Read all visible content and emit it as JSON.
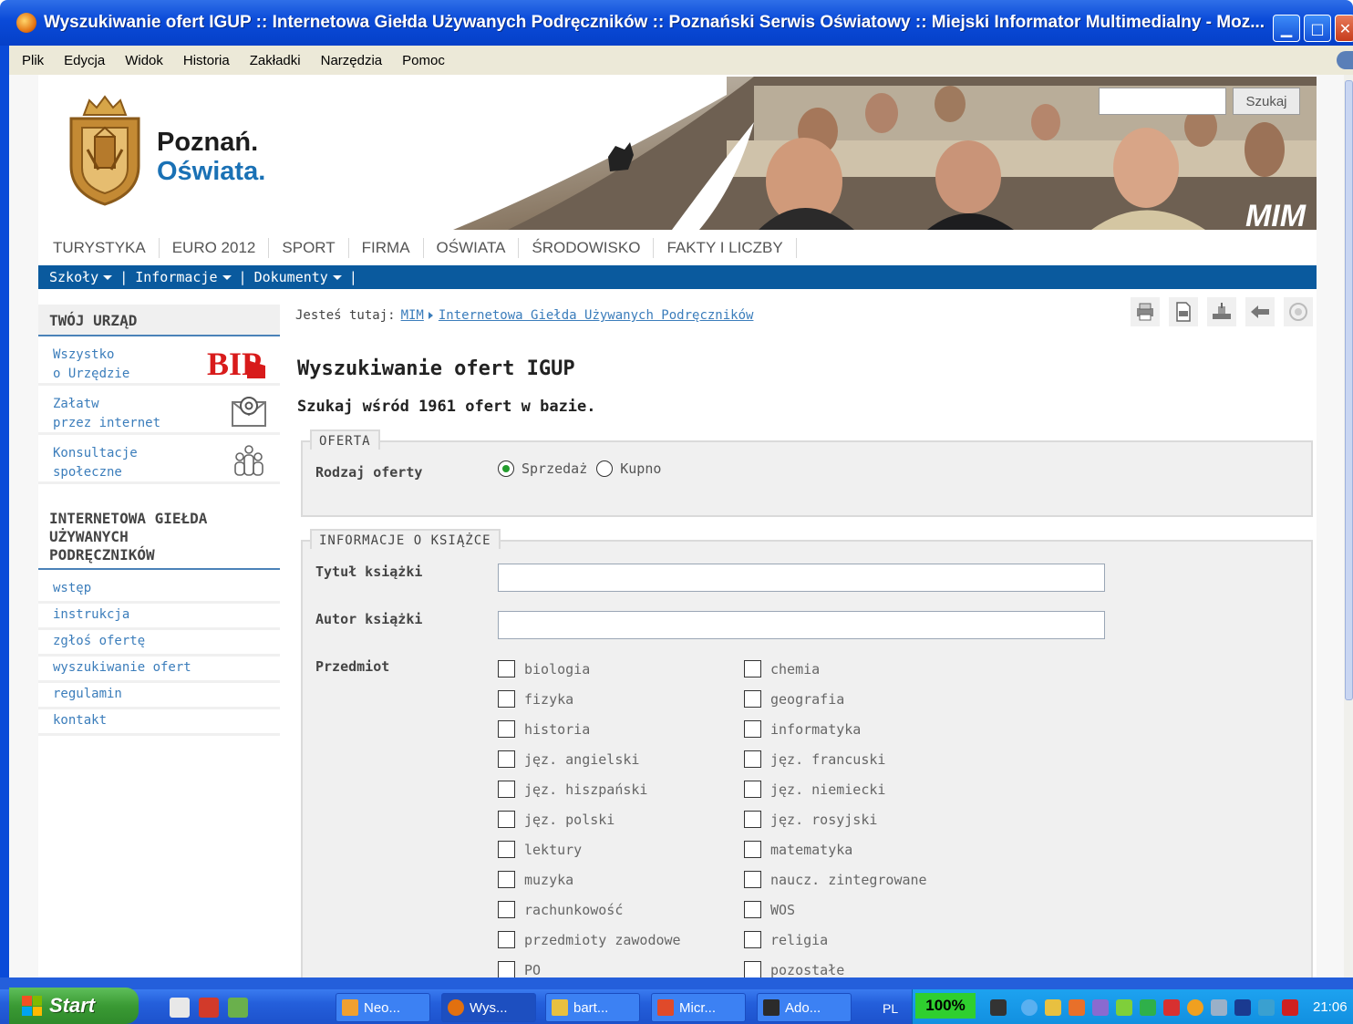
{
  "window": {
    "title": "Wyszukiwanie ofert IGUP :: Internetowa Giełda Używanych Podręczników :: Poznański Serwis Oświatowy :: Miejski Informator Multimedialny - Moz..."
  },
  "menubar": [
    "Plik",
    "Edycja",
    "Widok",
    "Historia",
    "Zakładki",
    "Narzędzia",
    "Pomoc"
  ],
  "header": {
    "brand_line1": "Poznań.",
    "brand_line2": "Oświata.",
    "banner_mark": "MIM",
    "search_button": "Szukaj",
    "search_value": ""
  },
  "mainnav": [
    "TURYSTYKA",
    "EURO 2012",
    "SPORT",
    "FIRMA",
    "OŚWIATA",
    "ŚRODOWISKO",
    "FAKTY I LICZBY"
  ],
  "subnav": [
    "Szkoły",
    "Informacje",
    "Dokumenty"
  ],
  "sidebar": {
    "urzad_heading": "TWÓJ URZĄD",
    "boxes": [
      {
        "line1": "Wszystko",
        "line2": "o Urzędzie",
        "icon": "bip-logo",
        "badge": "BIP"
      },
      {
        "line1": "Załatw",
        "line2": "przez internet",
        "icon": "at-icon"
      },
      {
        "line1": "Konsultacje",
        "line2": "społeczne",
        "icon": "people-icon"
      }
    ],
    "igup_heading": [
      "INTERNETOWA GIEŁDA",
      "UŻYWANYCH",
      "PODRĘCZNIKÓW"
    ],
    "links": [
      "wstęp",
      "instrukcja",
      "zgłoś ofertę",
      "wyszukiwanie ofert",
      "regulamin",
      "kontakt"
    ]
  },
  "breadcrumb": {
    "prefix": "Jesteś tutaj:",
    "items": [
      "MIM",
      "Internetowa Giełda Używanych Podręczników"
    ]
  },
  "tools": [
    "print-icon",
    "pdf-icon",
    "share-icon",
    "back-icon",
    "accessibility-icon"
  ],
  "main": {
    "title": "Wyszukiwanie ofert IGUP",
    "subtitle": "Szukaj wśród 1961 ofert w bazie.",
    "oferta": {
      "legend": "OFERTA",
      "label": "Rodzaj oferty",
      "options": [
        {
          "label": "Sprzedaż",
          "checked": true
        },
        {
          "label": "Kupno",
          "checked": false
        }
      ]
    },
    "ksiazka": {
      "legend": "INFORMACJE O KSIĄŻCE",
      "title_label": "Tytuł książki",
      "title_value": "",
      "author_label": "Autor książki",
      "author_value": "",
      "subject_label": "Przedmiot",
      "subjects_left": [
        "biologia",
        "fizyka",
        "historia",
        "jęz. angielski",
        "jęz. hiszpański",
        "jęz. polski",
        "lektury",
        "muzyka",
        "rachunkowość",
        "przedmioty zawodowe",
        "PO"
      ],
      "subjects_right": [
        "chemia",
        "geografia",
        "informatyka",
        "jęz. francuski",
        "jęz. niemiecki",
        "jęz. rosyjski",
        "matematyka",
        "naucz. zintegrowane",
        "WOS",
        "religia",
        "pozostałe"
      ]
    }
  },
  "taskbar": {
    "start": "Start",
    "tasks": [
      "Neo...",
      "Wys...",
      "bart...",
      "Micr...",
      "Ado..."
    ],
    "lang": "PL",
    "zoom": "100%",
    "clock": "21:06"
  },
  "colors": {
    "accent": "#0a5a9e",
    "link": "#3b7dbb",
    "brand_blue": "#1a71b5",
    "radio_selected": "#239c2d"
  }
}
